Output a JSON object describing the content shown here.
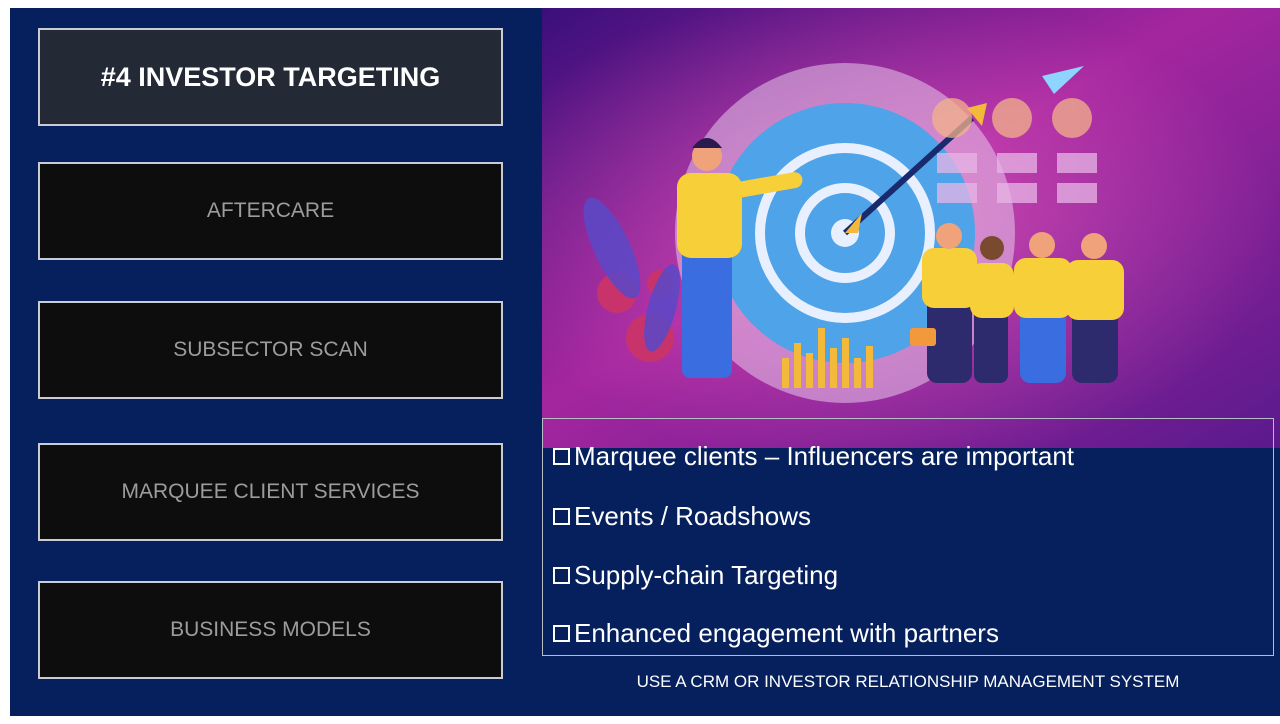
{
  "title": "#4 INVESTOR TARGETING",
  "nav": {
    "aftercare": "AFTERCARE",
    "subsector": "SUBSECTOR SCAN",
    "marquee": "MARQUEE CLIENT SERVICES",
    "business": "BUSINESS MODELS"
  },
  "bullets": [
    "Marquee clients – Influencers are important",
    "Events / Roadshows",
    "Supply-chain Targeting",
    "Enhanced engagement with partners"
  ],
  "footer": "USE A CRM OR INVESTOR RELATIONSHIP MANAGEMENT SYSTEM",
  "colors": {
    "background": "#05205c",
    "active_box": "#232a36",
    "inactive_box": "#0d0d0d",
    "accent_magenta": "#c62ea6"
  },
  "illustration": "investor-targeting-illustration"
}
